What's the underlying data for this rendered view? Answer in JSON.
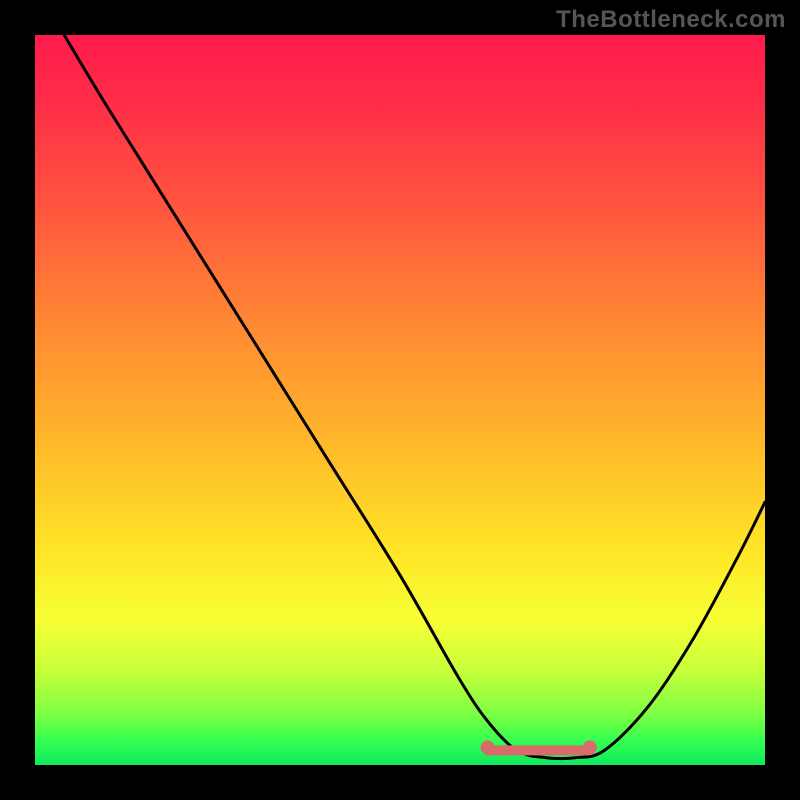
{
  "watermark": "TheBottleneck.com",
  "chart_data": {
    "type": "line",
    "title": "",
    "xlabel": "",
    "ylabel": "",
    "xlim": [
      0,
      100
    ],
    "ylim": [
      0,
      100
    ],
    "grid": false,
    "legend": false,
    "series": [
      {
        "name": "bottleneck-curve",
        "x": [
          4,
          10,
          20,
          30,
          40,
          50,
          58,
          62,
          66,
          70,
          74,
          78,
          84,
          90,
          96,
          100
        ],
        "y": [
          100,
          90,
          74,
          58,
          42,
          26,
          12,
          6,
          2,
          1,
          1,
          2,
          8,
          17,
          28,
          36
        ]
      }
    ],
    "highlight_segment": {
      "name": "optimal-range",
      "x_start": 62,
      "x_end": 76,
      "y": 2
    },
    "background_gradient": {
      "direction": "vertical",
      "stops": [
        {
          "pos": 0,
          "color": "#ff1a4b"
        },
        {
          "pos": 50,
          "color": "#ffb52b"
        },
        {
          "pos": 80,
          "color": "#f7ff33"
        },
        {
          "pos": 100,
          "color": "#11e85e"
        }
      ]
    }
  }
}
